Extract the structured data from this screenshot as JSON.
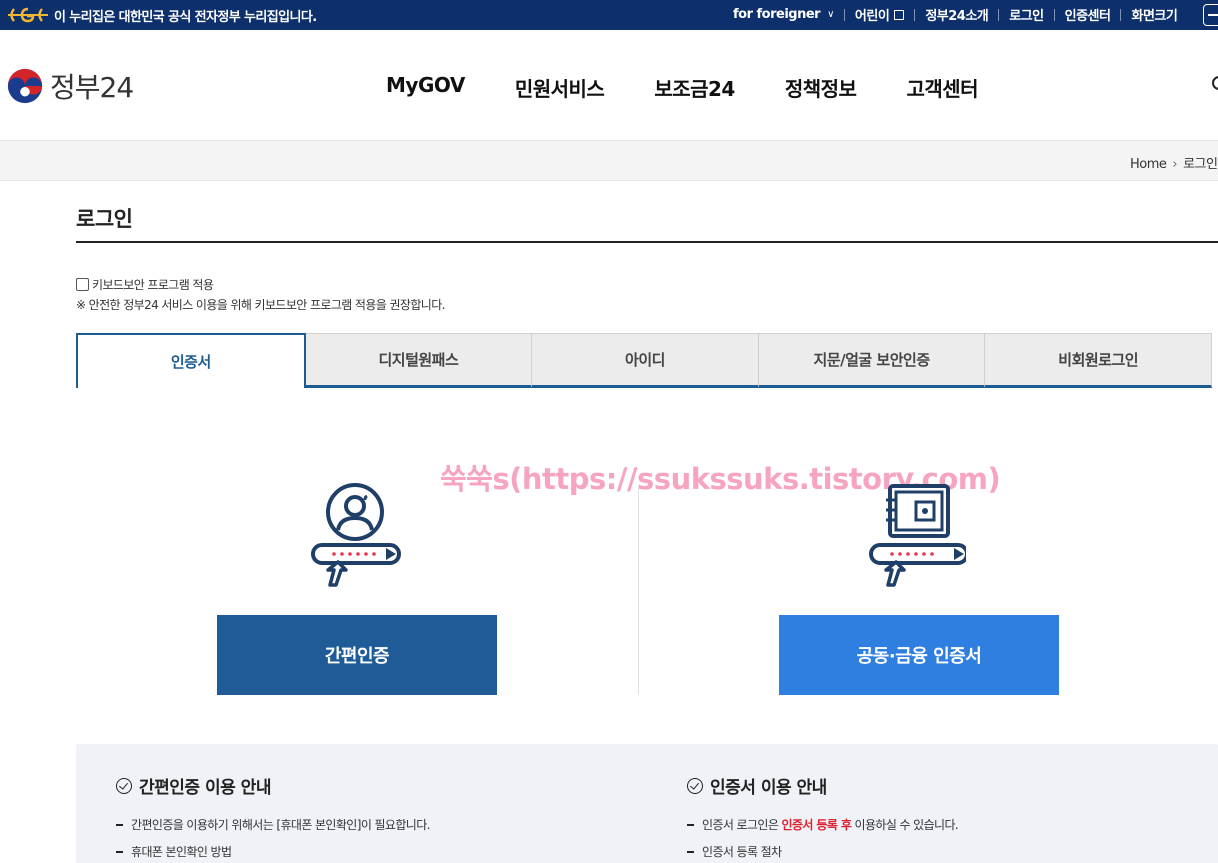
{
  "topbar": {
    "gov_notice": "이 누리집은 대한민국 공식 전자정부 누리집입니다.",
    "links": [
      {
        "label": "for foreigner"
      },
      {
        "label": "어린이"
      },
      {
        "label": "정부24소개"
      },
      {
        "label": "로그인"
      },
      {
        "label": "인증센터"
      },
      {
        "label": "화면크기"
      }
    ]
  },
  "header": {
    "logo_text": "정부24",
    "nav": [
      "MyGOV",
      "민원서비스",
      "보조금24",
      "정책정보",
      "고객센터"
    ]
  },
  "breadcrumb": {
    "home": "Home",
    "current": "로그인"
  },
  "page": {
    "title": "로그인",
    "keyboard_security_label": "키보드보안 프로그램 적용",
    "keyboard_security_note": "※ 안전한 정부24 서비스 이용을 위해 키보드보안 프로그램 적용을 권장합니다."
  },
  "tabs": [
    {
      "label": "인증서",
      "active": true
    },
    {
      "label": "디지털원패스",
      "active": false
    },
    {
      "label": "아이디",
      "active": false
    },
    {
      "label": "지문/얼굴 보안인증",
      "active": false
    },
    {
      "label": "비회원로그인",
      "active": false
    }
  ],
  "login_options": {
    "simple_auth_button": "간편인증",
    "cert_button": "공동·금융 인증서"
  },
  "watermark": "쑥쑥s(https://ssukssuks.tistory.com)",
  "guide": {
    "simple": {
      "title": "간편인증 이용 안내",
      "items": [
        "간편인증을 이용하기 위해서는 [휴대폰 본인확인]이 필요합니다.",
        "휴대폰 본인확인 방법"
      ]
    },
    "cert": {
      "title": "인증서 이용 안내",
      "item1_pre": "인증서 로그인은 ",
      "item1_em": "인증서 등록 후",
      "item1_post": " 이용하실 수 있습니다.",
      "item2": "인증서 등록 절차"
    }
  },
  "colors": {
    "topbar": "#0d2f6b",
    "tab_accent": "#1c5c93",
    "simple_button": "#1f5c97",
    "cert_button": "#2f7fe0",
    "emphasis_red": "#e0212e"
  }
}
